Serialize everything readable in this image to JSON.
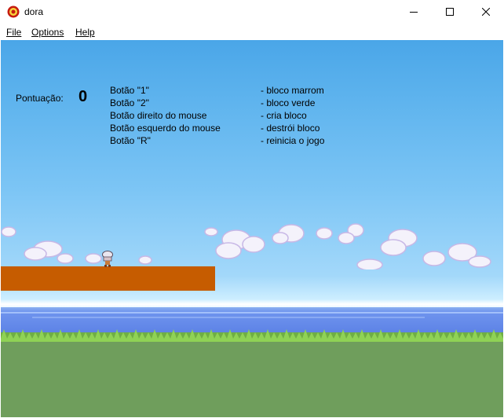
{
  "window": {
    "title": "dora"
  },
  "menu": {
    "file": "File",
    "options": "Options",
    "help": "Help"
  },
  "hud": {
    "score_label": "Pontuação:",
    "score": "0"
  },
  "controls": [
    {
      "key": "Botão \"1\"",
      "action": "- bloco marrom"
    },
    {
      "key": "Botão \"2\"",
      "action": "- bloco verde"
    },
    {
      "key": "Botão direito do mouse",
      "action": "- cria bloco"
    },
    {
      "key": "Botão esquerdo do mouse",
      "action": "- destrói bloco"
    },
    {
      "key": "Botão \"R\"",
      "action": "- reinicia o jogo"
    }
  ],
  "colors": {
    "sky": "#5fb4ee",
    "platform": "#c65c00",
    "sea": "#6f94ee",
    "grass": "#6f9e5c",
    "grass_light": "#9be35b"
  },
  "icons": {
    "app": "game-icon",
    "minimize": "minimize-icon",
    "maximize": "maximize-icon",
    "close": "close-icon"
  }
}
